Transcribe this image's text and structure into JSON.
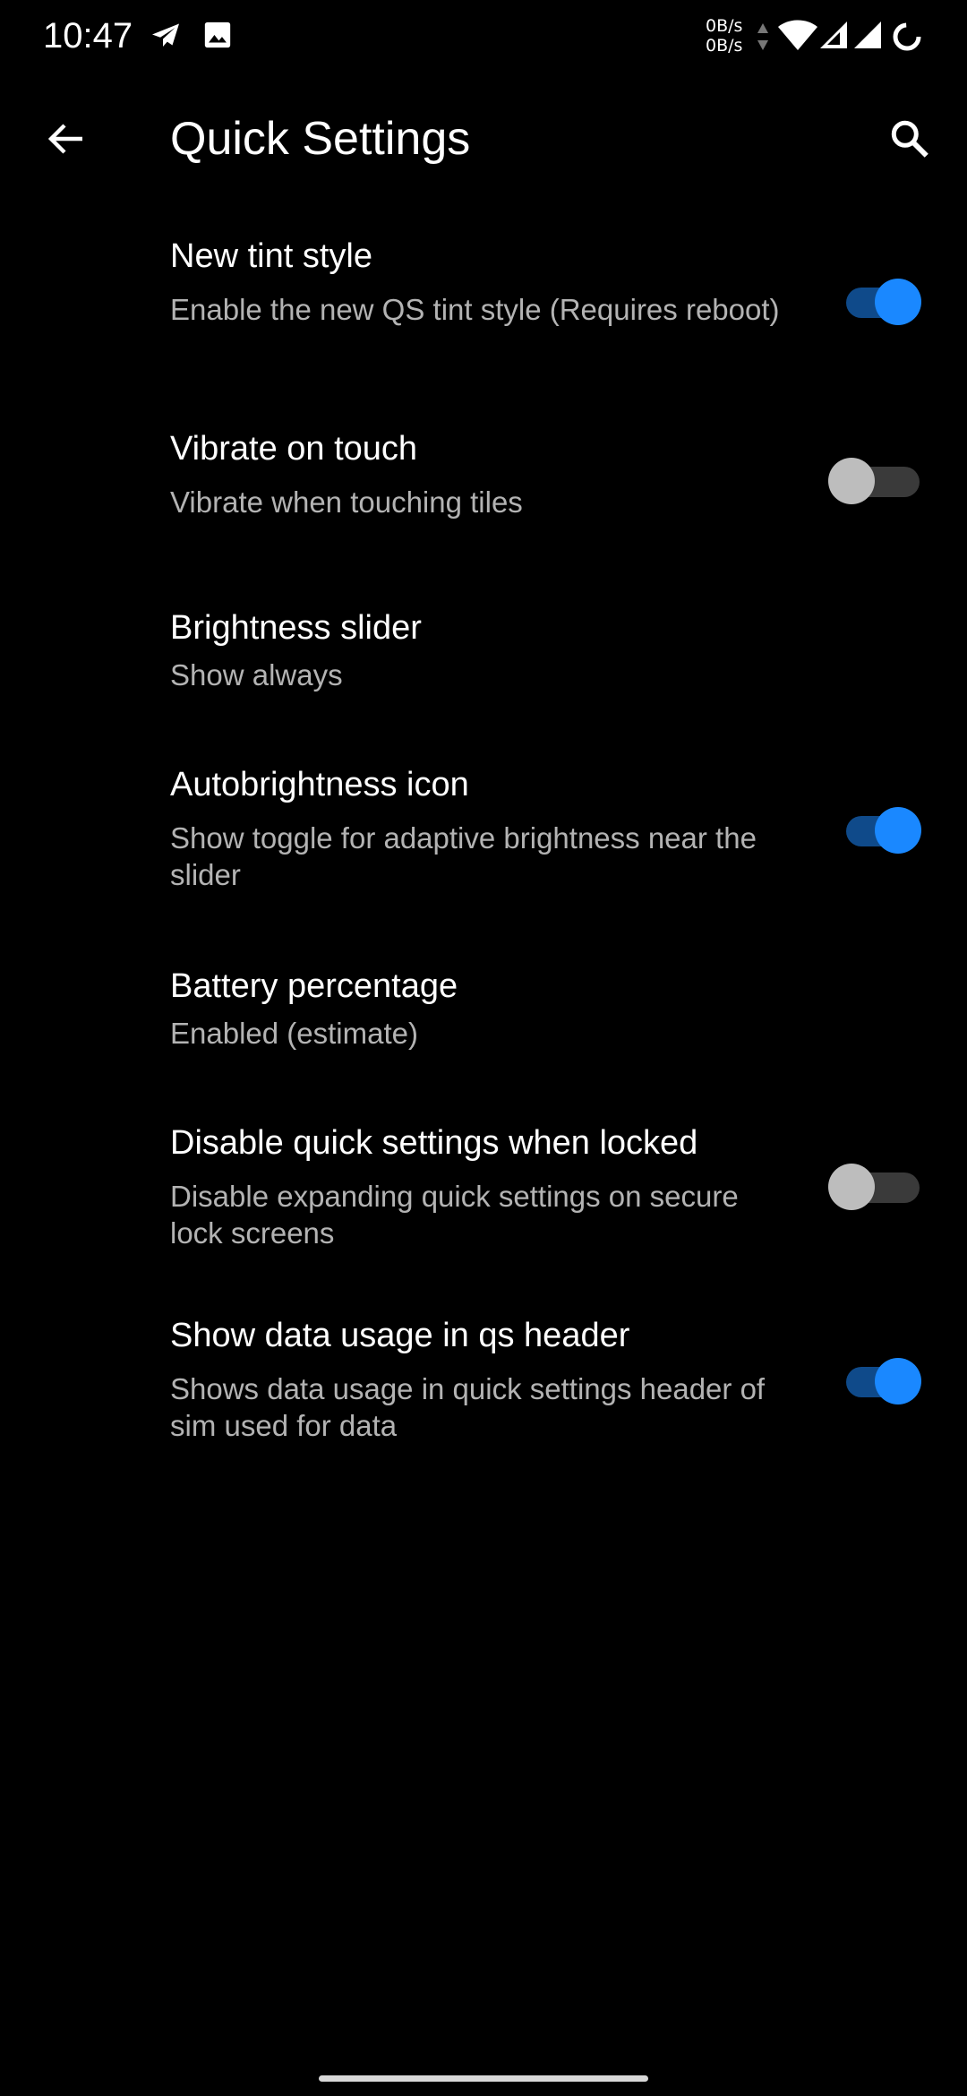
{
  "status_bar": {
    "time": "10:47",
    "icons": [
      "telegram-icon",
      "image-icon"
    ],
    "net_up": "0B/s",
    "net_down": "0B/s",
    "right_icons": [
      "data-arrows-icon",
      "wifi-icon",
      "signal-icon",
      "signal-icon",
      "battery-ring-icon"
    ]
  },
  "app_bar": {
    "title": "Quick Settings",
    "back_icon": "arrow-back-icon",
    "search_icon": "search-icon"
  },
  "preferences": [
    {
      "title": "New tint style",
      "summary": "Enable the new QS tint style (Requires reboot)",
      "toggle": true
    },
    {
      "title": "Vibrate on touch",
      "summary": "Vibrate when touching tiles",
      "toggle": false
    },
    {
      "title": "Brightness slider",
      "summary": "Show always"
    },
    {
      "title": "Autobrightness icon",
      "summary": "Show toggle for adaptive brightness near the slider",
      "toggle": true
    },
    {
      "title": "Battery percentage",
      "summary": "Enabled (estimate)"
    },
    {
      "title": "Disable quick settings when locked",
      "summary": "Disable expanding quick settings on secure lock screens",
      "toggle": false
    },
    {
      "title": "Show data usage in qs header",
      "summary": "Shows data usage in quick settings header of sim used for data",
      "toggle": true
    }
  ],
  "colors": {
    "background": "#000000",
    "accent": "#1a88ff",
    "summary_text": "#b3b3b3"
  }
}
